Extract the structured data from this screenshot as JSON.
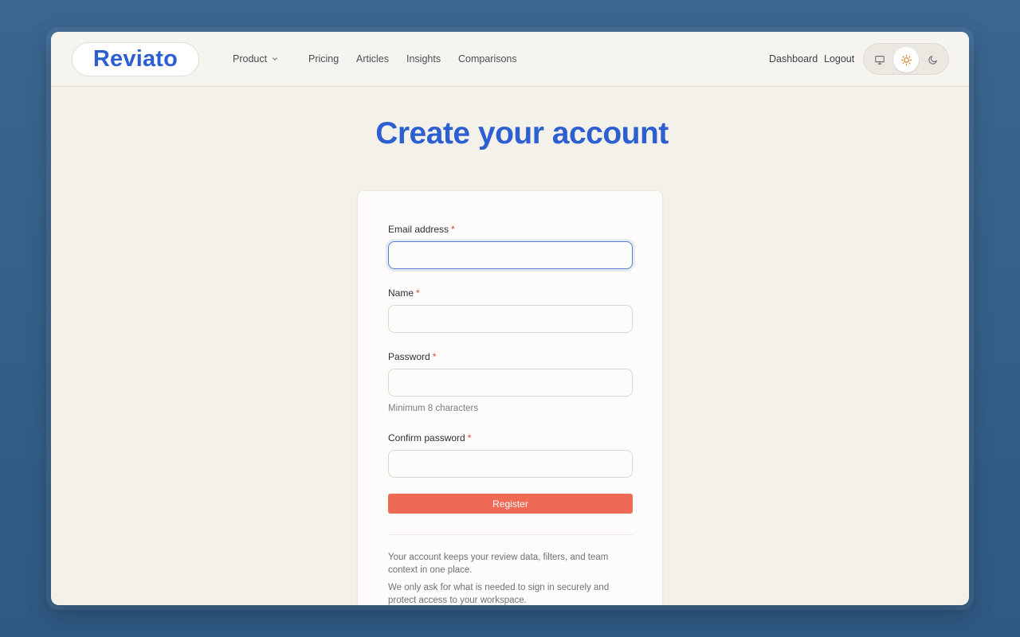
{
  "header": {
    "logo": "Reviato",
    "nav": [
      {
        "label": "Product",
        "has_dropdown": true
      },
      {
        "label": "Pricing"
      },
      {
        "label": "Articles"
      },
      {
        "label": "Insights"
      },
      {
        "label": "Comparisons"
      }
    ],
    "dashboard_label": "Dashboard",
    "logout_label": "Logout",
    "theme_options": [
      "monitor-icon",
      "sun-icon",
      "moon-icon"
    ],
    "theme_selected": "sun-icon"
  },
  "page": {
    "title": "Create your account"
  },
  "form": {
    "email": {
      "label": "Email address",
      "required": "*",
      "value": ""
    },
    "name": {
      "label": "Name",
      "required": "*",
      "value": ""
    },
    "password": {
      "label": "Password",
      "required": "*",
      "value": "",
      "hint": "Minimum 8 characters"
    },
    "confirm": {
      "label": "Confirm password",
      "required": "*",
      "value": ""
    },
    "submit_label": "Register"
  },
  "notes": [
    "Your account keeps your review data, filters, and team context in one place.",
    "We only ask for what is needed to sign in securely and protect access to your workspace."
  ],
  "colors": {
    "brand": "#2c5fd0",
    "primary_button": "#ef6a55",
    "required": "#d2473c",
    "background": "#2f5982"
  }
}
